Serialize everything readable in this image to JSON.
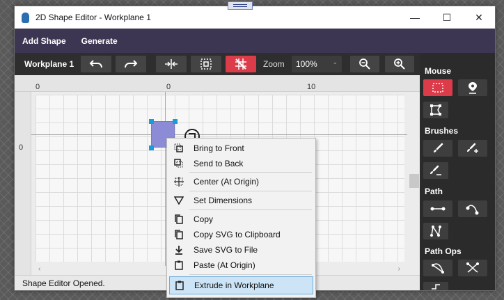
{
  "window": {
    "title": "2D Shape Editor - Workplane 1",
    "minimize": "—",
    "maximize": "☐",
    "close": "✕"
  },
  "menubar": {
    "items": [
      "Add Shape",
      "Generate"
    ]
  },
  "toolbar": {
    "workplane_label": "Workplane 1",
    "zoom_label": "Zoom",
    "zoom_value": "100%"
  },
  "ruler": {
    "h_labels": [
      "0",
      "0",
      "10"
    ],
    "v_labels": [
      "0"
    ]
  },
  "status": {
    "text": "Shape Editor Opened."
  },
  "right_panel": {
    "sections": [
      "Mouse",
      "Brushes",
      "Path",
      "Path Ops"
    ]
  },
  "context_menu": {
    "items": [
      "Bring to Front",
      "Send to Back",
      "Center (At Origin)",
      "Set Dimensions",
      "Copy",
      "Copy SVG to Clipboard",
      "Save SVG to File",
      "Paste (At Origin)",
      "Extrude in Workplane"
    ],
    "highlighted": "Extrude in Workplane"
  },
  "colors": {
    "accent_red": "#dc3c4a",
    "menubar": "#3d3652",
    "dark_panel": "#2b2b2b",
    "shape_fill": "#8c8cd6",
    "handle": "#1a9cd8",
    "highlight": "#cce4f5"
  }
}
